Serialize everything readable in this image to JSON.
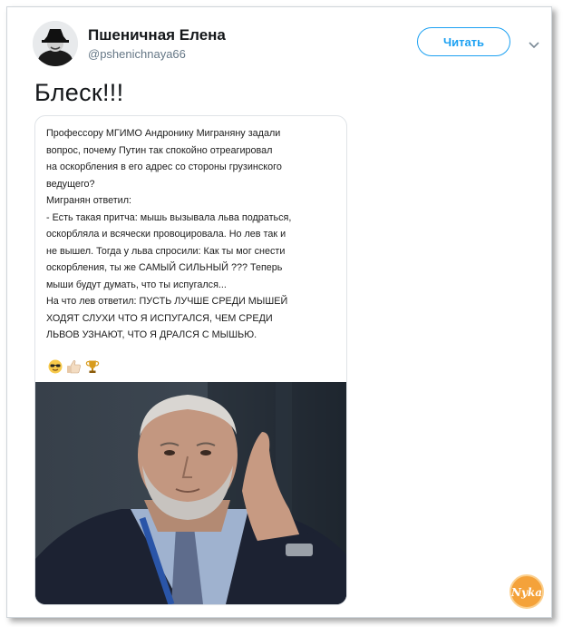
{
  "author": {
    "name": "Пшеничная Елена",
    "handle": "@pshenichnaya66"
  },
  "actions": {
    "follow_label": "Читать"
  },
  "tweet": {
    "text": "Блеск!!!"
  },
  "card": {
    "lines": [
      "Профессору МГИМО Андронику Миграняну задали",
      "вопрос, почему Путин так спокойно отреагировал",
      "на оскорбления в его адрес со стороны грузинского",
      "ведущего?",
      "Мигранян ответил:",
      "- Есть такая притча: мышь вызывала льва подраться,",
      "оскорбляла и всячески провоцировала. Но лев так и",
      "не вышел. Тогда у льва спросили: Как ты мог снести",
      "оскорбления, ты же САМЫЙ СИЛЬНЫЙ ??? Теперь",
      "мыши будут думать, что ты испугался...",
      "На что лев ответил: ПУСТЬ ЛУЧШЕ СРЕДИ МЫШЕЙ",
      "ХОДЯТ СЛУХИ ЧТО Я ИСПУГАЛСЯ, ЧЕМ СРЕДИ",
      "ЛЬВОВ УЗНАЮТ, ЧТО Я ДРАЛСЯ С МЫШЬЮ."
    ],
    "emojis": [
      "sunglasses-emoji",
      "thumbs-up-emoji",
      "trophy-emoji"
    ]
  },
  "watermark": {
    "text": "Nyka"
  },
  "colors": {
    "accent": "#1da1f2",
    "name": "#14171a",
    "secondary": "#657786"
  }
}
